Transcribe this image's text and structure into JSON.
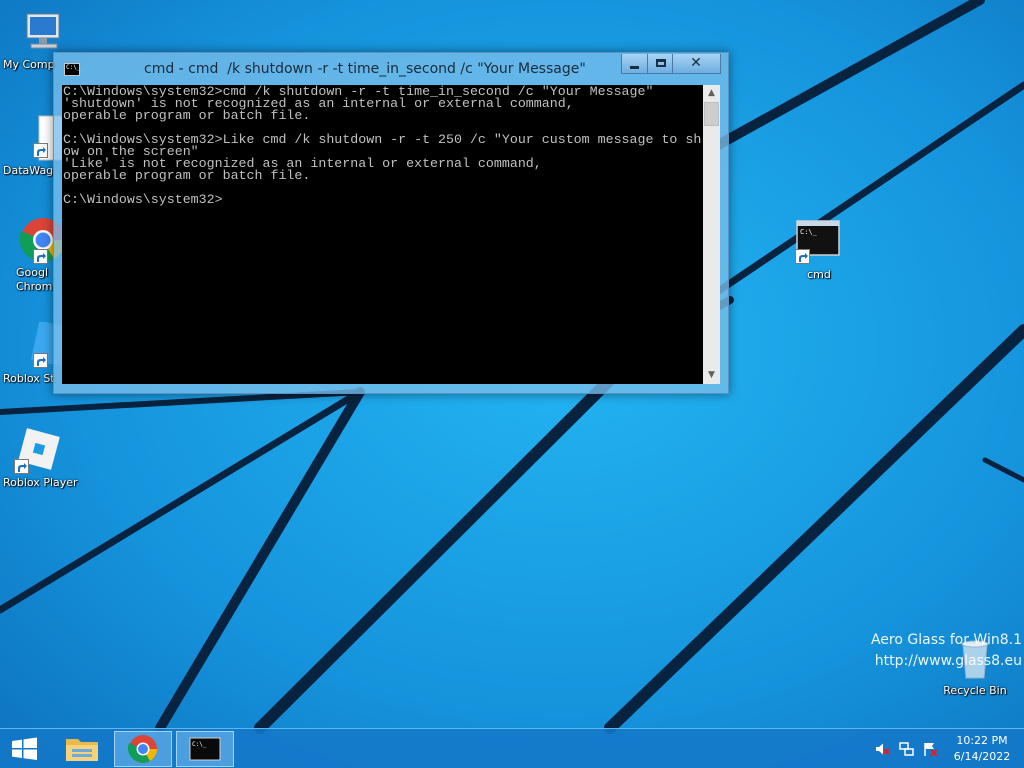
{
  "desktop": {
    "icons_left": [
      {
        "label": "My Comp",
        "icon": "computer-icon"
      },
      {
        "label": "DataWag",
        "icon": "document-icon"
      },
      {
        "label": "Googl Chrom",
        "icon": "chrome-icon"
      },
      {
        "label": "Roblox St",
        "icon": "roblox-studio-icon"
      },
      {
        "label": "Roblox Player",
        "icon": "roblox-player-icon"
      }
    ],
    "icons_right": [
      {
        "label": "cmd",
        "icon": "console-icon"
      },
      {
        "label": "Recycle Bin",
        "icon": "recycle-bin-icon"
      }
    ],
    "watermark": {
      "line1": "Aero Glass for Win8.1",
      "line2": "http://www.glass8.eu"
    }
  },
  "window": {
    "title": "cmd - cmd  /k shutdown -r -t time_in_second /c \"Your Message\"",
    "icon_text": "C:\\_",
    "close_glyph": "✕",
    "console_lines": [
      "C:\\Windows\\system32>cmd /k shutdown -r -t time_in_second /c \"Your Message\"",
      "'shutdown' is not recognized as an internal or external command,",
      "operable program or batch file.",
      "",
      "C:\\Windows\\system32>Like cmd /k shutdown -r -t 250 /c \"Your custom message to sh",
      "ow on the screen\"",
      "'Like' is not recognized as an internal or external command,",
      "operable program or batch file.",
      "",
      "C:\\Windows\\system32>"
    ],
    "scroll_up_glyph": "▲",
    "scroll_down_glyph": "▼"
  },
  "taskbar": {
    "time": "10:22 PM",
    "date": "6/14/2022",
    "cmd_icon_text": "C:\\_"
  },
  "colors": {
    "wallpaper": "#1a9be3",
    "console_bg": "#000000",
    "console_text": "#c0c0c0",
    "taskbar": "#1478c8"
  }
}
